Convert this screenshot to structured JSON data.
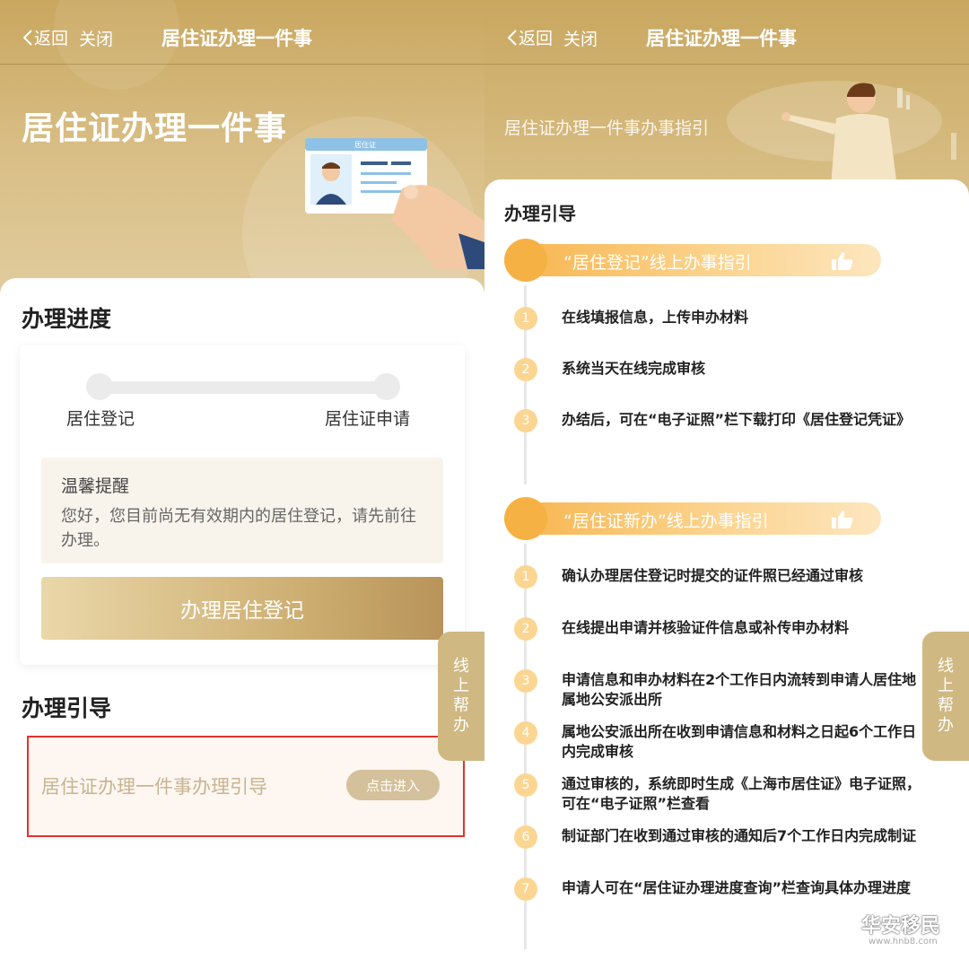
{
  "nav": {
    "back": "返回",
    "close": "关闭",
    "title": "居住证办理一件事"
  },
  "left": {
    "hero_title": "居住证办理一件事",
    "id_card_label": "居住证",
    "progress_title": "办理进度",
    "steps": [
      "居住登记",
      "居住证申请"
    ],
    "tip_title": "温馨提醒",
    "tip_text": "您好，您目前尚无有效期内的居住登记，请先前往办理。",
    "primary_button": "办理居住登记",
    "guide_title": "办理引导",
    "guide_link_text": "居住证办理一件事办理引导",
    "enter_button": "点击进入",
    "help_tab": "线上帮办"
  },
  "right": {
    "hero_subtitle": "居住证办理一件事办事指引",
    "guide_head": "办理引导",
    "sections": [
      {
        "title": "“居住登记”线上办事指引",
        "items": [
          {
            "num": "1",
            "text": "在线填报信息，上传申办材料"
          },
          {
            "num": "2",
            "text": "系统当天在线完成审核"
          },
          {
            "num": "3",
            "text": "办结后，可在“电子证照”栏下载打印《居住登记凭证》"
          }
        ]
      },
      {
        "title": "“居住证新办”线上办事指引",
        "items": [
          {
            "num": "1",
            "text": "确认办理居住登记时提交的证件照已经通过审核"
          },
          {
            "num": "2",
            "text": "在线提出申请并核验证件信息或补传申办材料"
          },
          {
            "num": "3",
            "text": "申请信息和申办材料在2个工作日内流转到申请人居住地属地公安派出所"
          },
          {
            "num": "4",
            "text": "属地公安派出所在收到申请信息和材料之日起6个工作日内完成审核"
          },
          {
            "num": "5",
            "text": "通过审核的，系统即时生成《上海市居住证》电子证照，可在“电子证照”栏查看"
          },
          {
            "num": "6",
            "text": "制证部门在收到通过审核的通知后7个工作日内完成制证"
          },
          {
            "num": "7",
            "text": "申请人可在“居住证办理进度查询”栏查询具体办理进度"
          }
        ]
      }
    ],
    "help_tab": "线上帮办"
  },
  "watermark": {
    "text": "华安移民",
    "url": "www.hnb8.com"
  },
  "colors": {
    "gold": "#c9a75f",
    "orange": "#f6b144",
    "red_box": "#e5322b",
    "tab": "#cfb882"
  }
}
